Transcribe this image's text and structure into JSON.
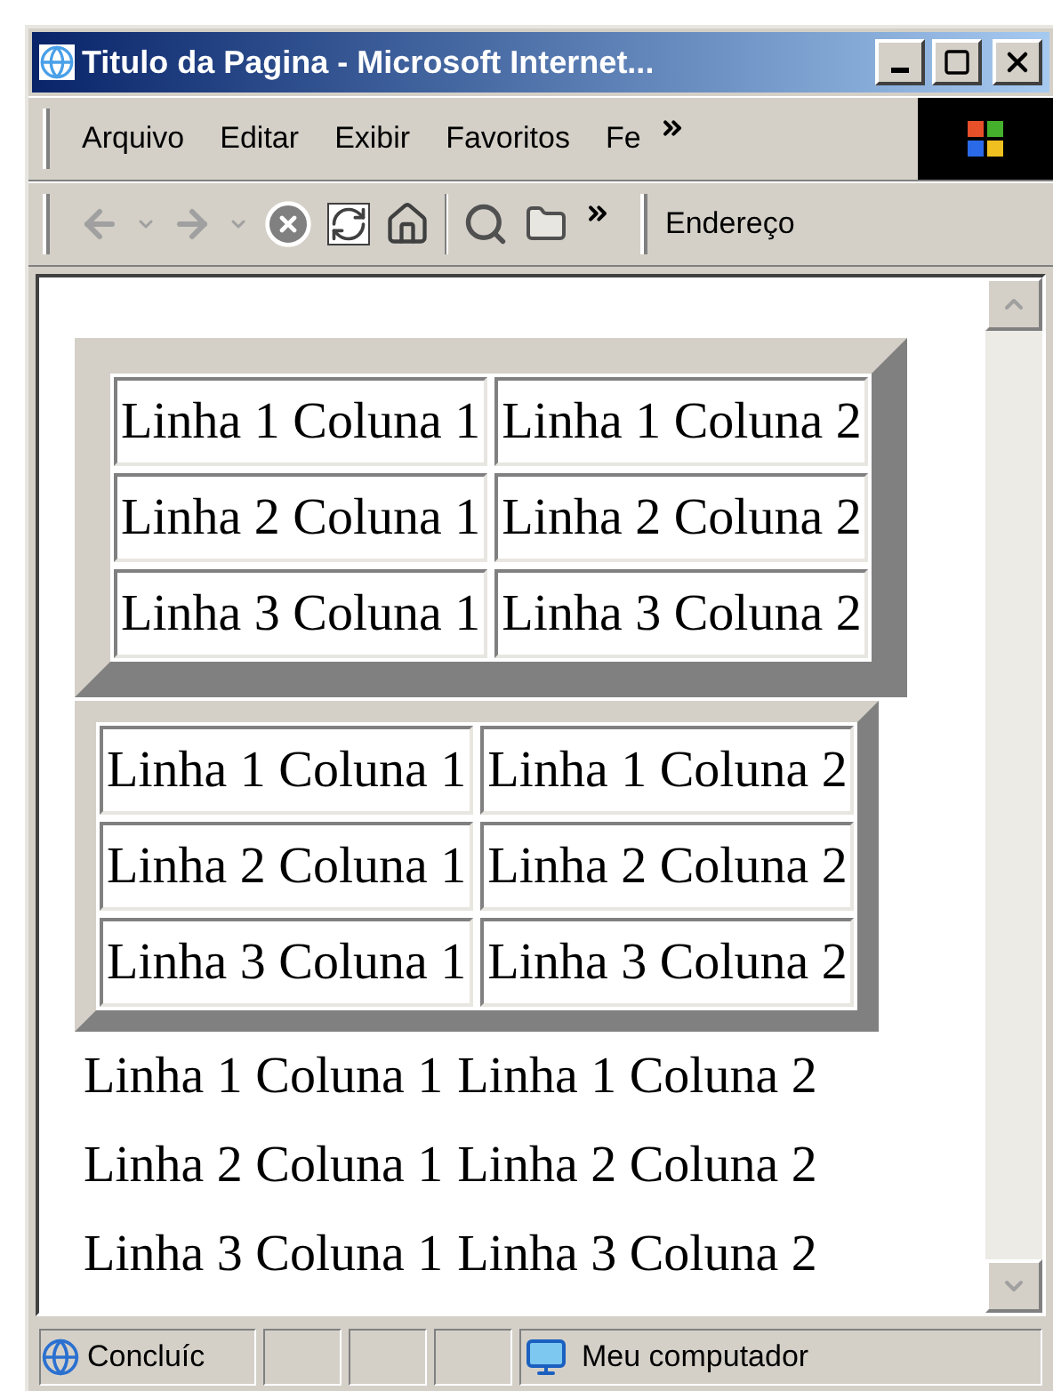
{
  "window": {
    "title": "Titulo da Pagina - Microsoft Internet..."
  },
  "menu": [
    "Arquivo",
    "Editar",
    "Exibir",
    "Favoritos",
    "Fe"
  ],
  "address_bar": {
    "label": "Endereço"
  },
  "tables": [
    {
      "kind": "thick",
      "rows": [
        [
          "Linha 1 Coluna 1",
          "Linha 1 Coluna 2"
        ],
        [
          "Linha 2 Coluna 1",
          "Linha 2 Coluna 2"
        ],
        [
          "Linha 3 Coluna 1",
          "Linha 3 Coluna 2"
        ]
      ]
    },
    {
      "kind": "thin",
      "rows": [
        [
          "Linha 1 Coluna 1",
          "Linha 1 Coluna 2"
        ],
        [
          "Linha 2 Coluna 1",
          "Linha 2 Coluna 2"
        ],
        [
          "Linha 3 Coluna 1",
          "Linha 3 Coluna 2"
        ]
      ]
    },
    {
      "kind": "borderless",
      "rows": [
        [
          "Linha 1 Coluna 1",
          "Linha 1 Coluna 2"
        ],
        [
          "Linha 2 Coluna 1",
          "Linha 2 Coluna 2"
        ],
        [
          "Linha 3 Coluna 1",
          "Linha 3 Coluna 2"
        ]
      ]
    }
  ],
  "status_bar": {
    "status": "Concluíc",
    "zone": "Meu computador"
  }
}
